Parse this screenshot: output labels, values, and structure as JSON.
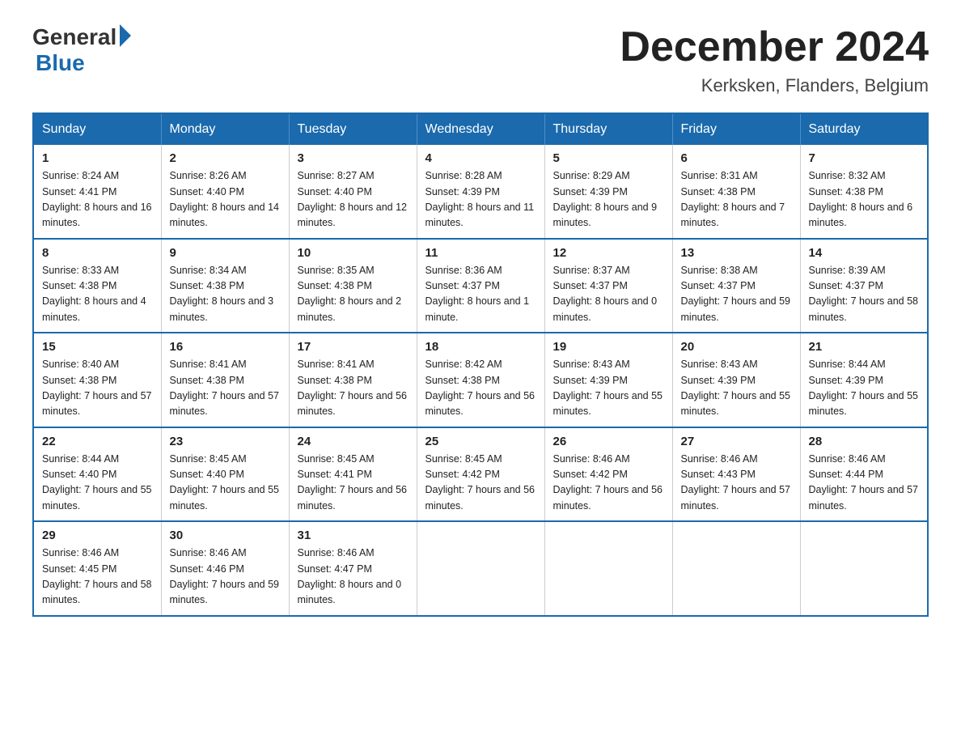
{
  "header": {
    "logo_general": "General",
    "logo_blue": "Blue",
    "month_title": "December 2024",
    "location": "Kerksken, Flanders, Belgium"
  },
  "days_of_week": [
    "Sunday",
    "Monday",
    "Tuesday",
    "Wednesday",
    "Thursday",
    "Friday",
    "Saturday"
  ],
  "weeks": [
    [
      {
        "num": "1",
        "sunrise": "8:24 AM",
        "sunset": "4:41 PM",
        "daylight": "8 hours and 16 minutes."
      },
      {
        "num": "2",
        "sunrise": "8:26 AM",
        "sunset": "4:40 PM",
        "daylight": "8 hours and 14 minutes."
      },
      {
        "num": "3",
        "sunrise": "8:27 AM",
        "sunset": "4:40 PM",
        "daylight": "8 hours and 12 minutes."
      },
      {
        "num": "4",
        "sunrise": "8:28 AM",
        "sunset": "4:39 PM",
        "daylight": "8 hours and 11 minutes."
      },
      {
        "num": "5",
        "sunrise": "8:29 AM",
        "sunset": "4:39 PM",
        "daylight": "8 hours and 9 minutes."
      },
      {
        "num": "6",
        "sunrise": "8:31 AM",
        "sunset": "4:38 PM",
        "daylight": "8 hours and 7 minutes."
      },
      {
        "num": "7",
        "sunrise": "8:32 AM",
        "sunset": "4:38 PM",
        "daylight": "8 hours and 6 minutes."
      }
    ],
    [
      {
        "num": "8",
        "sunrise": "8:33 AM",
        "sunset": "4:38 PM",
        "daylight": "8 hours and 4 minutes."
      },
      {
        "num": "9",
        "sunrise": "8:34 AM",
        "sunset": "4:38 PM",
        "daylight": "8 hours and 3 minutes."
      },
      {
        "num": "10",
        "sunrise": "8:35 AM",
        "sunset": "4:38 PM",
        "daylight": "8 hours and 2 minutes."
      },
      {
        "num": "11",
        "sunrise": "8:36 AM",
        "sunset": "4:37 PM",
        "daylight": "8 hours and 1 minute."
      },
      {
        "num": "12",
        "sunrise": "8:37 AM",
        "sunset": "4:37 PM",
        "daylight": "8 hours and 0 minutes."
      },
      {
        "num": "13",
        "sunrise": "8:38 AM",
        "sunset": "4:37 PM",
        "daylight": "7 hours and 59 minutes."
      },
      {
        "num": "14",
        "sunrise": "8:39 AM",
        "sunset": "4:37 PM",
        "daylight": "7 hours and 58 minutes."
      }
    ],
    [
      {
        "num": "15",
        "sunrise": "8:40 AM",
        "sunset": "4:38 PM",
        "daylight": "7 hours and 57 minutes."
      },
      {
        "num": "16",
        "sunrise": "8:41 AM",
        "sunset": "4:38 PM",
        "daylight": "7 hours and 57 minutes."
      },
      {
        "num": "17",
        "sunrise": "8:41 AM",
        "sunset": "4:38 PM",
        "daylight": "7 hours and 56 minutes."
      },
      {
        "num": "18",
        "sunrise": "8:42 AM",
        "sunset": "4:38 PM",
        "daylight": "7 hours and 56 minutes."
      },
      {
        "num": "19",
        "sunrise": "8:43 AM",
        "sunset": "4:39 PM",
        "daylight": "7 hours and 55 minutes."
      },
      {
        "num": "20",
        "sunrise": "8:43 AM",
        "sunset": "4:39 PM",
        "daylight": "7 hours and 55 minutes."
      },
      {
        "num": "21",
        "sunrise": "8:44 AM",
        "sunset": "4:39 PM",
        "daylight": "7 hours and 55 minutes."
      }
    ],
    [
      {
        "num": "22",
        "sunrise": "8:44 AM",
        "sunset": "4:40 PM",
        "daylight": "7 hours and 55 minutes."
      },
      {
        "num": "23",
        "sunrise": "8:45 AM",
        "sunset": "4:40 PM",
        "daylight": "7 hours and 55 minutes."
      },
      {
        "num": "24",
        "sunrise": "8:45 AM",
        "sunset": "4:41 PM",
        "daylight": "7 hours and 56 minutes."
      },
      {
        "num": "25",
        "sunrise": "8:45 AM",
        "sunset": "4:42 PM",
        "daylight": "7 hours and 56 minutes."
      },
      {
        "num": "26",
        "sunrise": "8:46 AM",
        "sunset": "4:42 PM",
        "daylight": "7 hours and 56 minutes."
      },
      {
        "num": "27",
        "sunrise": "8:46 AM",
        "sunset": "4:43 PM",
        "daylight": "7 hours and 57 minutes."
      },
      {
        "num": "28",
        "sunrise": "8:46 AM",
        "sunset": "4:44 PM",
        "daylight": "7 hours and 57 minutes."
      }
    ],
    [
      {
        "num": "29",
        "sunrise": "8:46 AM",
        "sunset": "4:45 PM",
        "daylight": "7 hours and 58 minutes."
      },
      {
        "num": "30",
        "sunrise": "8:46 AM",
        "sunset": "4:46 PM",
        "daylight": "7 hours and 59 minutes."
      },
      {
        "num": "31",
        "sunrise": "8:46 AM",
        "sunset": "4:47 PM",
        "daylight": "8 hours and 0 minutes."
      },
      null,
      null,
      null,
      null
    ]
  ]
}
